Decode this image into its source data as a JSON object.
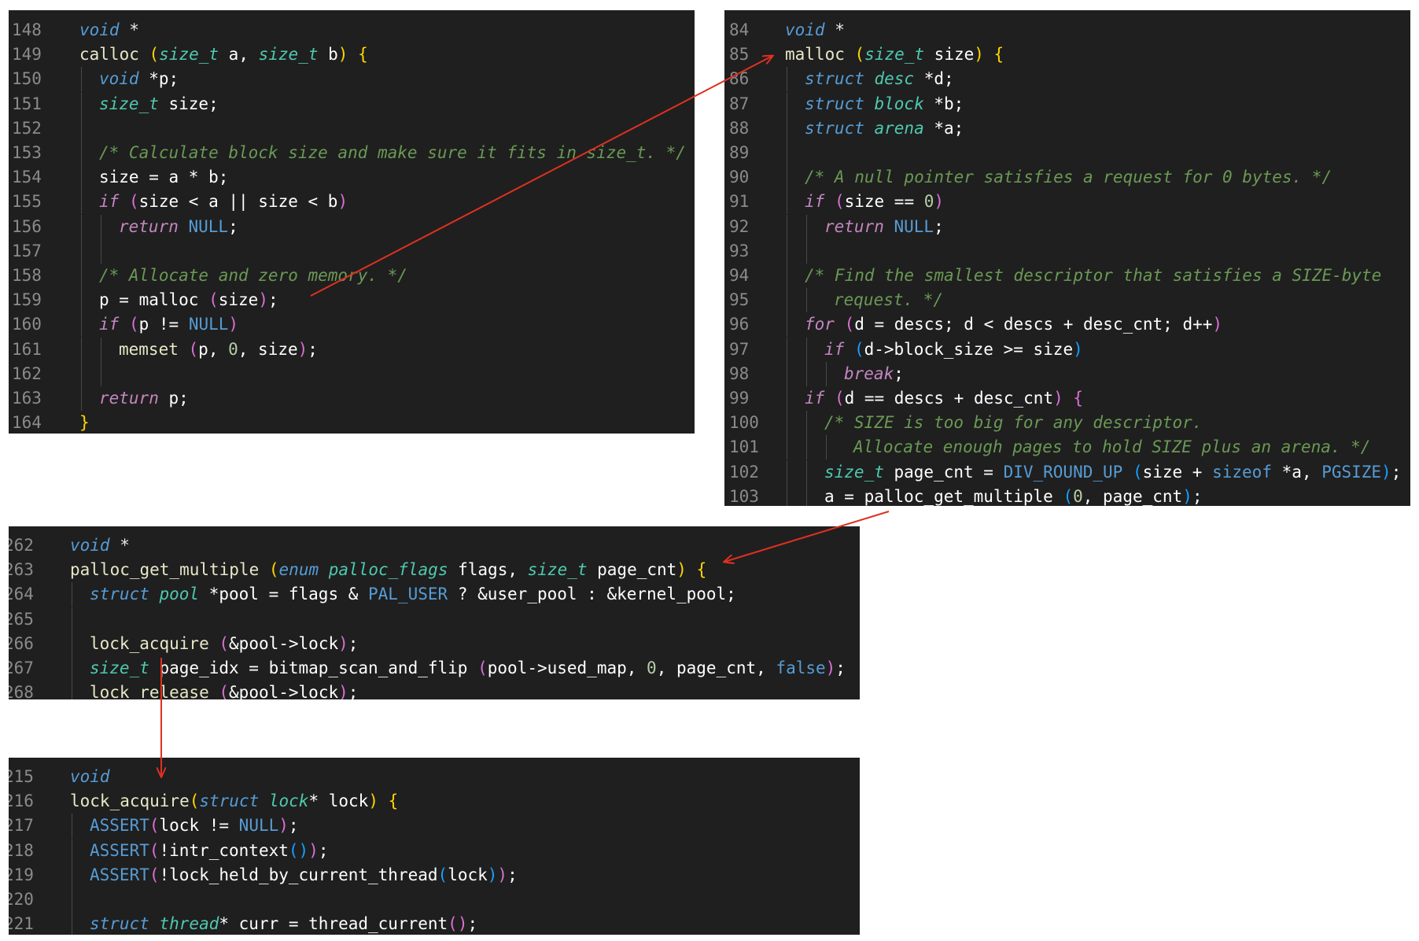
{
  "colors": {
    "background": "#ffffff",
    "panel": "#1f1f1f",
    "line_number": "#8b8b8b",
    "arrow": "#e03020"
  },
  "panels": [
    {
      "id": "calloc",
      "lines": [
        {
          "n": "148",
          "indent": 0,
          "tokens": [
            [
              "void",
              "sto"
            ],
            [
              " *",
              "op"
            ]
          ]
        },
        {
          "n": "149",
          "indent": 0,
          "tokens": [
            [
              "calloc ",
              "fn"
            ],
            [
              "(",
              "p1"
            ],
            [
              "size_t",
              "type"
            ],
            [
              " a, ",
              "var"
            ],
            [
              "size_t",
              "type"
            ],
            [
              " b",
              "var"
            ],
            [
              ")",
              "p1"
            ],
            [
              " {",
              "p1"
            ]
          ]
        },
        {
          "n": "150",
          "indent": 1,
          "tokens": [
            [
              "void",
              "sto"
            ],
            [
              " *p;",
              "var"
            ]
          ]
        },
        {
          "n": "151",
          "indent": 1,
          "tokens": [
            [
              "size_t",
              "type"
            ],
            [
              " size;",
              "var"
            ]
          ]
        },
        {
          "n": "152",
          "indent": 1,
          "tokens": []
        },
        {
          "n": "153",
          "indent": 1,
          "tokens": [
            [
              "/* Calculate block size and make sure it fits in size_t. */",
              "com"
            ]
          ]
        },
        {
          "n": "154",
          "indent": 1,
          "tokens": [
            [
              "size = a * b;",
              "var"
            ]
          ]
        },
        {
          "n": "155",
          "indent": 1,
          "tokens": [
            [
              "if",
              "kw"
            ],
            [
              " (",
              "p2"
            ],
            [
              "size < a || size < b",
              "var"
            ],
            [
              ")",
              "p2"
            ]
          ]
        },
        {
          "n": "156",
          "indent": 2,
          "tokens": [
            [
              "return",
              "kw"
            ],
            [
              " NULL",
              "con"
            ],
            [
              ";",
              "var"
            ]
          ]
        },
        {
          "n": "157",
          "indent": 2,
          "tokens": []
        },
        {
          "n": "158",
          "indent": 1,
          "tokens": [
            [
              "/* Allocate and zero memory. */",
              "com"
            ]
          ]
        },
        {
          "n": "159",
          "indent": 1,
          "tokens": [
            [
              "p = malloc ",
              "var"
            ],
            [
              "(",
              "p2"
            ],
            [
              "size",
              "var"
            ],
            [
              ")",
              "p2"
            ],
            [
              ";",
              "var"
            ]
          ]
        },
        {
          "n": "160",
          "indent": 1,
          "tokens": [
            [
              "if",
              "kw"
            ],
            [
              " (",
              "p2"
            ],
            [
              "p != ",
              "var"
            ],
            [
              "NULL",
              "con"
            ],
            [
              ")",
              "p2"
            ]
          ]
        },
        {
          "n": "161",
          "indent": 2,
          "tokens": [
            [
              "memset ",
              "fn"
            ],
            [
              "(",
              "p2"
            ],
            [
              "p, ",
              "var"
            ],
            [
              "0",
              "num"
            ],
            [
              ", size",
              "var"
            ],
            [
              ")",
              "p2"
            ],
            [
              ";",
              "var"
            ]
          ]
        },
        {
          "n": "162",
          "indent": 2,
          "tokens": []
        },
        {
          "n": "163",
          "indent": 1,
          "tokens": [
            [
              "return",
              "kw"
            ],
            [
              " p;",
              "var"
            ]
          ]
        },
        {
          "n": "164",
          "indent": 0,
          "tokens": [
            [
              "}",
              "p1"
            ]
          ]
        }
      ]
    },
    {
      "id": "malloc",
      "lines": [
        {
          "n": "84",
          "indent": 0,
          "tokens": [
            [
              "void",
              "sto"
            ],
            [
              " *",
              "op"
            ]
          ]
        },
        {
          "n": "85",
          "indent": 0,
          "tokens": [
            [
              "malloc ",
              "fn"
            ],
            [
              "(",
              "p1"
            ],
            [
              "size_t",
              "type"
            ],
            [
              " size",
              "var"
            ],
            [
              ")",
              "p1"
            ],
            [
              " {",
              "p1"
            ]
          ]
        },
        {
          "n": "86",
          "indent": 1,
          "tokens": [
            [
              "struct",
              "sto"
            ],
            [
              " desc",
              "type"
            ],
            [
              " *d;",
              "var"
            ]
          ]
        },
        {
          "n": "87",
          "indent": 1,
          "tokens": [
            [
              "struct",
              "sto"
            ],
            [
              " block",
              "type"
            ],
            [
              " *b;",
              "var"
            ]
          ]
        },
        {
          "n": "88",
          "indent": 1,
          "tokens": [
            [
              "struct",
              "sto"
            ],
            [
              " arena",
              "type"
            ],
            [
              " *a;",
              "var"
            ]
          ]
        },
        {
          "n": "89",
          "indent": 1,
          "tokens": []
        },
        {
          "n": "90",
          "indent": 1,
          "tokens": [
            [
              "/* A null pointer satisfies a request for 0 bytes. */",
              "com"
            ]
          ]
        },
        {
          "n": "91",
          "indent": 1,
          "tokens": [
            [
              "if",
              "kw"
            ],
            [
              " (",
              "p2"
            ],
            [
              "size == ",
              "var"
            ],
            [
              "0",
              "num"
            ],
            [
              ")",
              "p2"
            ]
          ]
        },
        {
          "n": "92",
          "indent": 2,
          "tokens": [
            [
              "return",
              "kw"
            ],
            [
              " NULL",
              "con"
            ],
            [
              ";",
              "var"
            ]
          ]
        },
        {
          "n": "93",
          "indent": 2,
          "tokens": []
        },
        {
          "n": "94",
          "indent": 1,
          "tokens": [
            [
              "/* Find the smallest descriptor that satisfies a SIZE-byte",
              "com"
            ]
          ]
        },
        {
          "n": "95",
          "indent": 2,
          "half": true,
          "tokens": [
            [
              "request. */",
              "com"
            ]
          ]
        },
        {
          "n": "96",
          "indent": 1,
          "tokens": [
            [
              "for",
              "kw"
            ],
            [
              " (",
              "p2"
            ],
            [
              "d = descs; d < descs + desc_cnt; d++",
              "var"
            ],
            [
              ")",
              "p2"
            ]
          ]
        },
        {
          "n": "97",
          "indent": 2,
          "tokens": [
            [
              "if",
              "kw"
            ],
            [
              " (",
              "p3"
            ],
            [
              "d->block_size >= size",
              "var"
            ],
            [
              ")",
              "p3"
            ]
          ]
        },
        {
          "n": "98",
          "indent": 3,
          "tokens": [
            [
              "break",
              "kw"
            ],
            [
              ";",
              "var"
            ]
          ]
        },
        {
          "n": "99",
          "indent": 1,
          "tokens": [
            [
              "if",
              "kw"
            ],
            [
              " (",
              "p2"
            ],
            [
              "d == descs + desc_cnt",
              "var"
            ],
            [
              ")",
              "p2"
            ],
            [
              " {",
              "p2"
            ]
          ]
        },
        {
          "n": "100",
          "indent": 2,
          "tokens": [
            [
              "/* SIZE is too big for any descriptor.",
              "com"
            ]
          ]
        },
        {
          "n": "101",
          "indent": 3,
          "half": true,
          "tokens": [
            [
              "Allocate enough pages to hold SIZE plus an arena. */",
              "com"
            ]
          ]
        },
        {
          "n": "102",
          "indent": 2,
          "tokens": [
            [
              "size_t",
              "type"
            ],
            [
              " page_cnt = ",
              "var"
            ],
            [
              "DIV_ROUND_UP",
              "con"
            ],
            [
              " (",
              "p3"
            ],
            [
              "size + ",
              "var"
            ],
            [
              "sizeof",
              "con"
            ],
            [
              " *a, ",
              "var"
            ],
            [
              "PGSIZE",
              "con"
            ],
            [
              ")",
              "p3"
            ],
            [
              ";",
              "var"
            ]
          ]
        },
        {
          "n": "103",
          "indent": 2,
          "tokens": [
            [
              "a = palloc_get_multiple ",
              "var"
            ],
            [
              "(",
              "p3"
            ],
            [
              "0",
              "num"
            ],
            [
              ", page_cnt",
              "var"
            ],
            [
              ")",
              "p3"
            ],
            [
              ";",
              "var"
            ]
          ]
        }
      ]
    },
    {
      "id": "palloc",
      "lines": [
        {
          "n": "262",
          "indent": 0,
          "tokens": [
            [
              "void",
              "sto"
            ],
            [
              " *",
              "op"
            ]
          ]
        },
        {
          "n": "263",
          "indent": 0,
          "tokens": [
            [
              "palloc_get_multiple ",
              "fn"
            ],
            [
              "(",
              "p1"
            ],
            [
              "enum",
              "sto"
            ],
            [
              " palloc_flags",
              "type"
            ],
            [
              " flags, ",
              "var"
            ],
            [
              "size_t",
              "type"
            ],
            [
              " page_cnt",
              "var"
            ],
            [
              ")",
              "p1"
            ],
            [
              " {",
              "p1"
            ]
          ]
        },
        {
          "n": "264",
          "indent": 1,
          "tokens": [
            [
              "struct",
              "sto"
            ],
            [
              " pool",
              "type"
            ],
            [
              " *pool = flags & ",
              "var"
            ],
            [
              "PAL_USER",
              "con"
            ],
            [
              " ? &user_pool : &kernel_pool;",
              "var"
            ]
          ]
        },
        {
          "n": "265",
          "indent": 1,
          "tokens": []
        },
        {
          "n": "266",
          "indent": 1,
          "tokens": [
            [
              "lock_acquire ",
              "fn"
            ],
            [
              "(",
              "p2"
            ],
            [
              "&pool->lock",
              "var"
            ],
            [
              ")",
              "p2"
            ],
            [
              ";",
              "var"
            ]
          ]
        },
        {
          "n": "267",
          "indent": 1,
          "tokens": [
            [
              "size_t",
              "type"
            ],
            [
              " page_idx = bitmap_scan_and_flip ",
              "var"
            ],
            [
              "(",
              "p2"
            ],
            [
              "pool->used_map, ",
              "var"
            ],
            [
              "0",
              "num"
            ],
            [
              ", page_cnt, ",
              "var"
            ],
            [
              "false",
              "con"
            ],
            [
              ")",
              "p2"
            ],
            [
              ";",
              "var"
            ]
          ]
        },
        {
          "n": "268",
          "indent": 1,
          "tokens": [
            [
              "lock_release ",
              "fn"
            ],
            [
              "(",
              "p2"
            ],
            [
              "&pool->lock",
              "var"
            ],
            [
              ")",
              "p2"
            ],
            [
              ";",
              "var"
            ]
          ]
        }
      ]
    },
    {
      "id": "lock",
      "lines": [
        {
          "n": "215",
          "indent": 0,
          "tokens": [
            [
              "void",
              "sto"
            ]
          ]
        },
        {
          "n": "216",
          "indent": 0,
          "tokens": [
            [
              "lock_acquire",
              "fn"
            ],
            [
              "(",
              "p1"
            ],
            [
              "struct",
              "sto"
            ],
            [
              " lock",
              "type"
            ],
            [
              "* lock",
              "var"
            ],
            [
              ")",
              "p1"
            ],
            [
              " {",
              "p1"
            ]
          ]
        },
        {
          "n": "217",
          "indent": 1,
          "tokens": [
            [
              "ASSERT",
              "con"
            ],
            [
              "(",
              "p2"
            ],
            [
              "lock != ",
              "var"
            ],
            [
              "NULL",
              "con"
            ],
            [
              ")",
              "p2"
            ],
            [
              ";",
              "var"
            ]
          ]
        },
        {
          "n": "218",
          "indent": 1,
          "tokens": [
            [
              "ASSERT",
              "con"
            ],
            [
              "(",
              "p2"
            ],
            [
              "!intr_context",
              "var"
            ],
            [
              "()",
              "p3"
            ],
            [
              ")",
              "p2"
            ],
            [
              ";",
              "var"
            ]
          ]
        },
        {
          "n": "219",
          "indent": 1,
          "tokens": [
            [
              "ASSERT",
              "con"
            ],
            [
              "(",
              "p2"
            ],
            [
              "!lock_held_by_current_thread",
              "var"
            ],
            [
              "(",
              "p3"
            ],
            [
              "lock",
              "var"
            ],
            [
              ")",
              "p3"
            ],
            [
              ")",
              "p2"
            ],
            [
              ";",
              "var"
            ]
          ]
        },
        {
          "n": "220",
          "indent": 1,
          "tokens": []
        },
        {
          "n": "221",
          "indent": 1,
          "tokens": [
            [
              "struct",
              "sto"
            ],
            [
              " thread",
              "type"
            ],
            [
              "* curr = thread_current",
              "var"
            ],
            [
              "()",
              "p2"
            ],
            [
              ";",
              "var"
            ]
          ]
        }
      ]
    }
  ]
}
